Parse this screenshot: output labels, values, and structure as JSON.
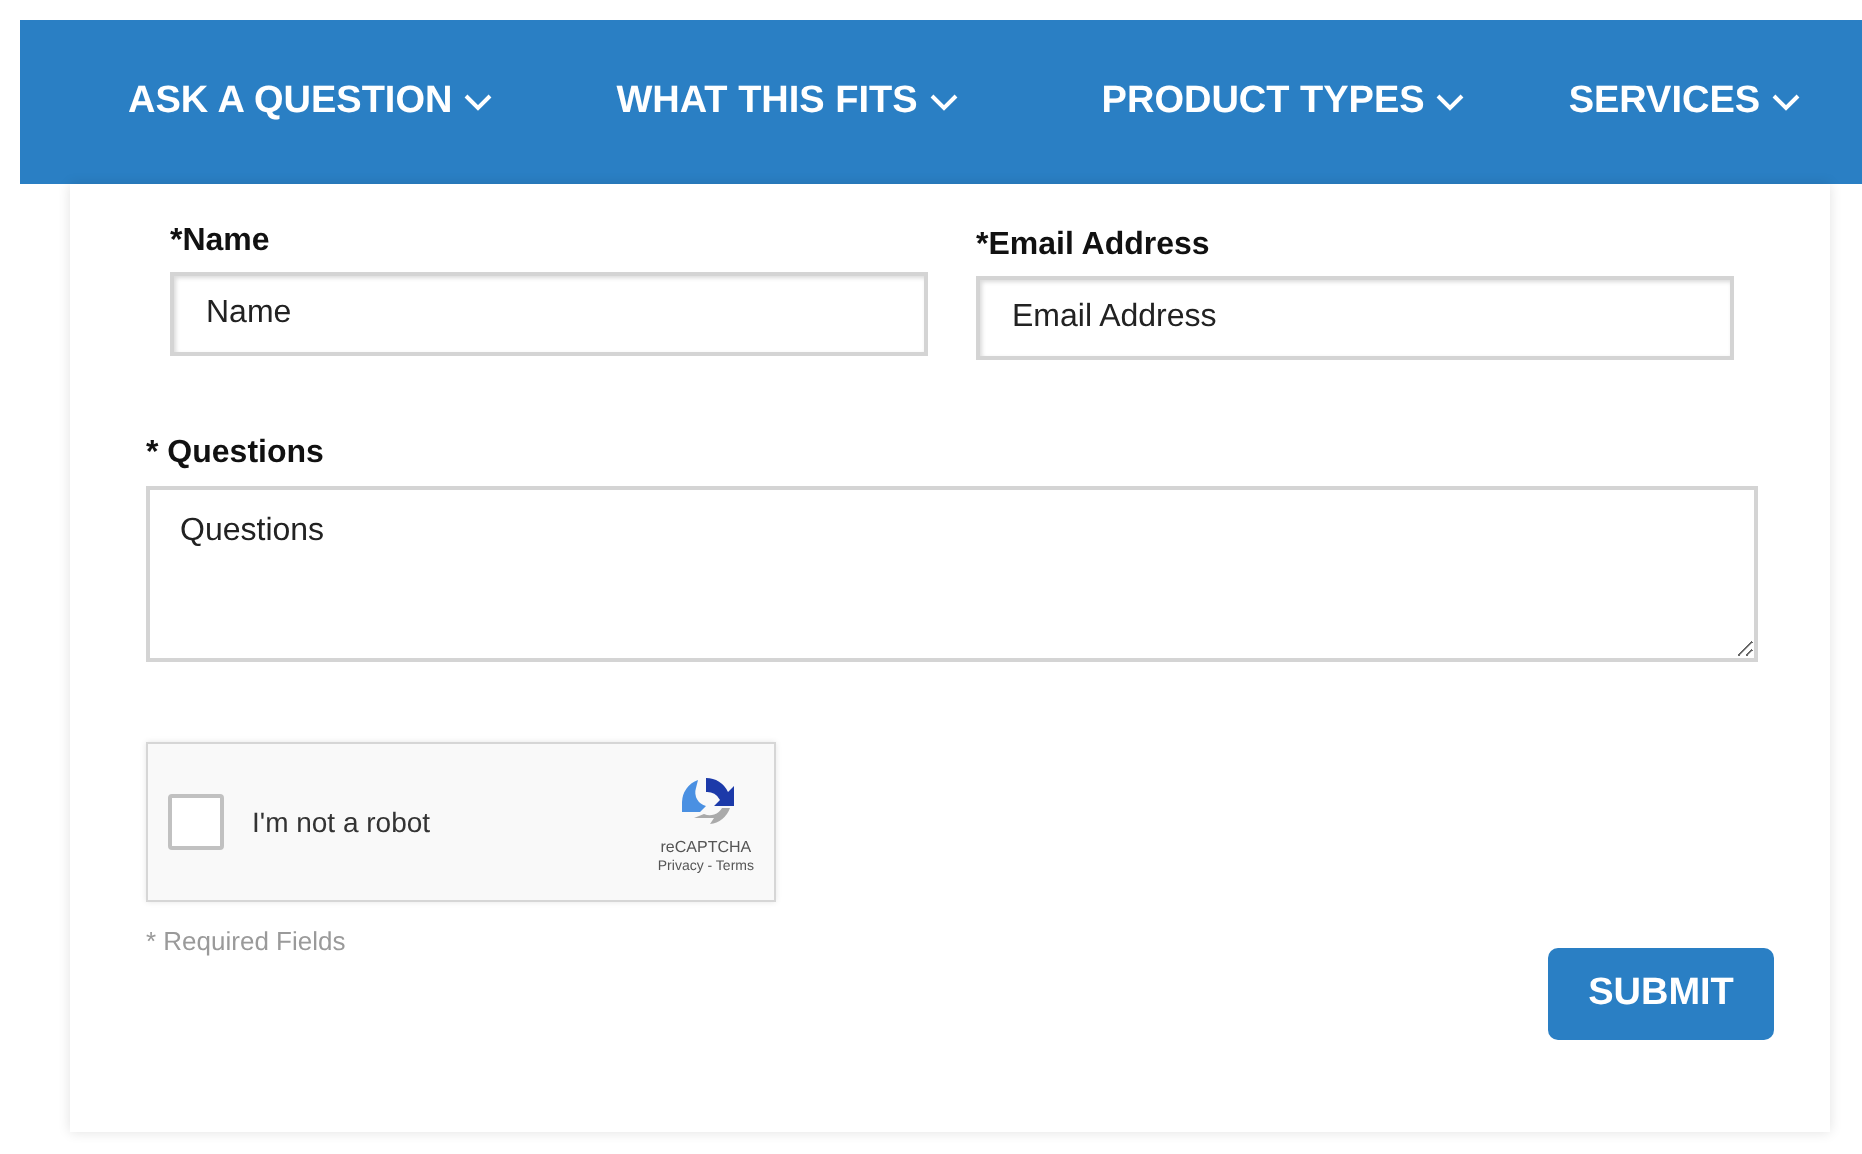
{
  "nav": {
    "items": [
      {
        "label": "ASK A QUESTION"
      },
      {
        "label": "WHAT THIS FITS"
      },
      {
        "label": "PRODUCT TYPES"
      },
      {
        "label": "SERVICES"
      }
    ]
  },
  "form": {
    "name": {
      "label": "*Name",
      "placeholder": "Name"
    },
    "email": {
      "label": "*Email Address",
      "placeholder": "Email Address"
    },
    "questions": {
      "label": "* Questions",
      "placeholder": "Questions"
    },
    "captcha": {
      "label": "I'm not a robot",
      "checked": false,
      "brand": "reCAPTCHA",
      "links": "Privacy - Terms"
    },
    "required_note": "* Required Fields",
    "submit": "SUBMIT"
  }
}
